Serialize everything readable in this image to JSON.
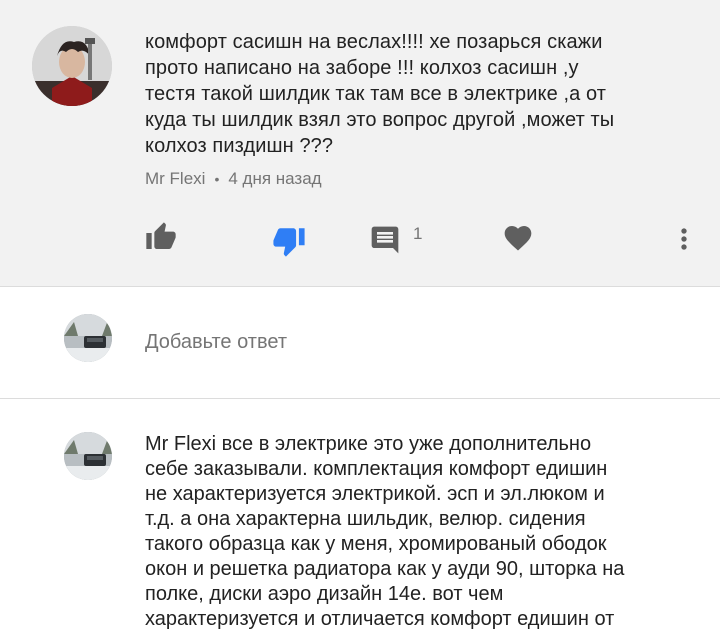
{
  "comment": {
    "text": "комфорт сасишн  на веслах!!!! хе позарься скажи\nпрото написано на заборе !!! колхоз сасишн   ,у\nтестя такой шилдик так там все в электрике ,а от\nкуда ты шилдик взял это вопрос другой ,может ты\nколхоз пиздишн ???",
    "author": "Mr Flexi",
    "separator": "•",
    "time": "4 дня назад",
    "icons": {
      "like": "thumbs-up-icon",
      "dislike": "thumbs-down-icon",
      "reply": "comment-icon",
      "heart": "heart-icon",
      "more": "more-vert-icon"
    },
    "reply_count": "1",
    "colors": {
      "dislike_active": "#2f7ef5",
      "icon": "#5f5f5f"
    }
  },
  "reply_input": {
    "placeholder": "Добавьте ответ"
  },
  "reply": {
    "text": "Mr Flexi все в электрике это уже дополнительно\nсебе заказывали. комплектация комфорт едишин\nне характеризуется электрикой. эсп и эл.люком и\nт.д. а она характерна шильдик, велюр. сидения\nтакого образца как у меня, хромированый ободок\nокон и решетка радиатора как у ауди 90, шторка на\nполке, диски аэро дизайн 14е. вот чем\nхарактеризуется и отличается комфорт едишин от"
  }
}
